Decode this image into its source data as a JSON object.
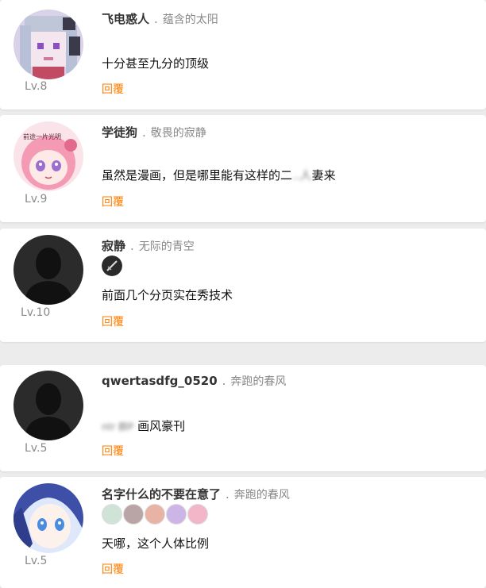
{
  "comments": [
    {
      "username": "飞电惑人",
      "separator": ".",
      "title": "蕴含的太阳",
      "level": "Lv.8",
      "content": "十分甚至九分的顶级",
      "reply": "回覆",
      "avatar": "pixel-anime-girl-avatar"
    },
    {
      "username": "学徒狗",
      "separator": ".",
      "title": "敬畏的寂静",
      "level": "Lv.9",
      "content": "虽然是漫画，但是哪里能有这样的二",
      "content_blurred": "..人",
      "content_after": "妻来",
      "avatar_text": "前途一片光明",
      "reply": "回覆",
      "avatar": "pink-hair-anime-avatar"
    },
    {
      "username": "寂静",
      "separator": ".",
      "title": "无际的青空",
      "level": "Lv.10",
      "content": "前面几个分页实在秀技术",
      "reply": "回覆",
      "avatar": "default-silhouette-avatar",
      "badge": "sword-badge-icon"
    },
    {
      "username": "qwertasdfg_0520",
      "separator": ".",
      "title": "奔跑的春风",
      "level": "Lv.5",
      "content_blurred": "ntr 群P",
      "content": "画风豪刊",
      "reply": "回覆",
      "avatar": "default-silhouette-avatar"
    },
    {
      "username": "名字什么的不要在意了",
      "separator": ".",
      "title": "奔跑的春风",
      "level": "Lv.5",
      "content": "天哪，这个人体比例",
      "reply": "回覆",
      "avatar": "blue-hair-anime-avatar",
      "badges": [
        "#cfe3d6",
        "#b9a4a6",
        "#e8b2a5",
        "#cdb5e6",
        "#f2b6c8"
      ]
    }
  ],
  "colors": {
    "reply": "#ff7d00",
    "background": "#ececec"
  }
}
